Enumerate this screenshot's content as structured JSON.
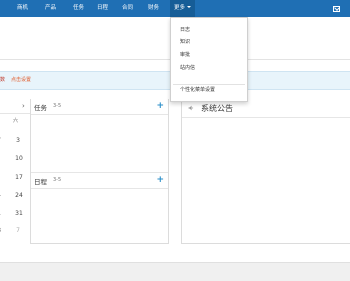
{
  "nav": {
    "items": [
      {
        "label": "商机"
      },
      {
        "label": "产品"
      },
      {
        "label": "任务"
      },
      {
        "label": "日程"
      },
      {
        "label": "合同"
      },
      {
        "label": "财务"
      },
      {
        "label": "更多"
      }
    ]
  },
  "notice_bar": {
    "left_text": "数",
    "link_text": "点击设置"
  },
  "calendar": {
    "chevron": "›",
    "weekday": "六",
    "days": [
      "3",
      "10",
      "17",
      "24",
      "31",
      "7"
    ],
    "left_days": [
      "7",
      "4",
      "1",
      "8"
    ]
  },
  "tasks": {
    "label": "任务",
    "range": "3-5",
    "add": "+"
  },
  "schedule": {
    "label": "日程",
    "range": "3-5",
    "add": "+"
  },
  "announcement": {
    "title": "系统公告"
  },
  "dropdown": {
    "items": [
      "日志",
      "知识",
      "审批",
      "站内信"
    ],
    "personal": "个性化菜单设置"
  },
  "colors": {
    "nav_bg": "#1f6fb4",
    "accent": "#2a8ec9",
    "notice_bg": "#e8f4fb"
  }
}
